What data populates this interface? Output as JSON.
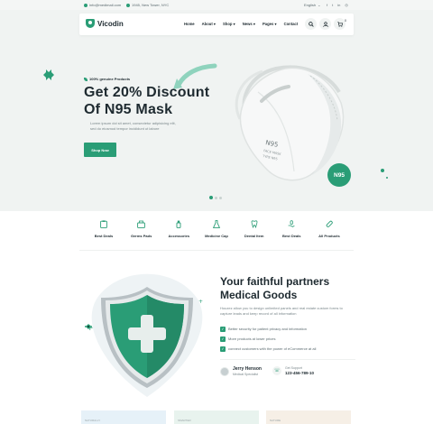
{
  "topbar": {
    "email": "info@medimail.com",
    "address": "1945, New Tower, NYC",
    "language": "English",
    "language_caret": "⌄",
    "social": [
      "f",
      "t",
      "in",
      "◎"
    ]
  },
  "header": {
    "logo_text": "Vicodin",
    "menu": [
      "Home",
      "About",
      "Shop",
      "News",
      "Pages",
      "Contact"
    ],
    "cart_count": "0"
  },
  "hero": {
    "badge": "100% genuine Products",
    "title_line1": "Get 20% Discount",
    "title_line2": "Of N95 Mask",
    "desc_line1": "Lorem ipsum dol sit amet, consectetur adipisicing elit,",
    "desc_line2": "sed do eiusmod tempor incididunt ut labore",
    "button": "Shop Now",
    "mask_badge": "N95",
    "mask_print1": "N95",
    "mask_print2": "FACE MASK",
    "mask_print3": "TYPE N95"
  },
  "categories": [
    {
      "label": "Best Deals"
    },
    {
      "label": "Germs Pads"
    },
    {
      "label": "Accessories"
    },
    {
      "label": "Medicine Cap"
    },
    {
      "label": "Dental Item"
    },
    {
      "label": "Best Deals"
    },
    {
      "label": "All Products"
    }
  ],
  "partners": {
    "title_line1": "Your faithful partners",
    "title_line2": "Medical Goods",
    "desc": "Houzez allow you to design unlimited panels and real estate custom forms to capture leads and keep record of all information",
    "checks": [
      "Better security for patient privacy and information",
      "More products at lower prices",
      "connect customers with the power of eCommerce at all"
    ],
    "person_name": "Jerry Henson",
    "person_role": "Medical Specialist",
    "support_label": "Get Support",
    "support_phone": "123-456-789-10"
  },
  "bottom_cards": [
    "NATURALLY",
    "SMARTER",
    "NATURE"
  ],
  "colors": {
    "accent": "#2a9d76",
    "dark": "#1e2a30",
    "muted": "#7a878b",
    "hero_bg": "#f0f3f2"
  }
}
